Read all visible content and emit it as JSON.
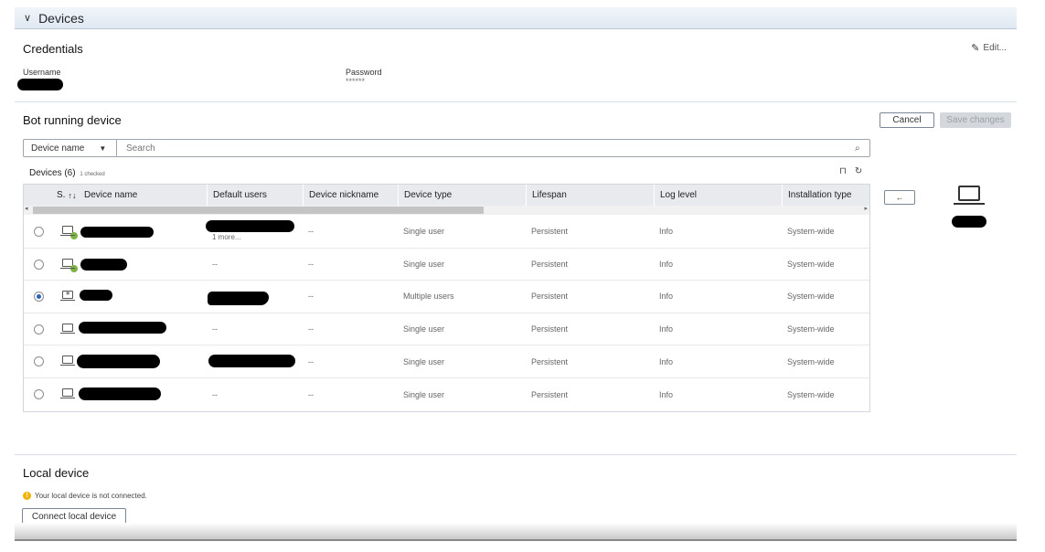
{
  "section": {
    "title": "Devices",
    "chevron_icon": "chevron-down-icon"
  },
  "credentials": {
    "title": "Credentials",
    "edit_label": "Edit...",
    "username_label": "Username",
    "password_label": "Password",
    "password_value": "******"
  },
  "bot": {
    "title": "Bot running device",
    "cancel_label": "Cancel",
    "save_label": "Save changes",
    "search": {
      "filter_label": "Device name",
      "placeholder": "Search"
    },
    "devices_count": "Devices (6)",
    "checked_label": "1 checked",
    "arrow_label": "←"
  },
  "table": {
    "headers": [
      "S.",
      "Device name",
      "Default users",
      "Device nickname",
      "Device type",
      "Lifespan",
      "Log level",
      "Installation type"
    ],
    "sort_icon": "↑↓",
    "rows": [
      {
        "selected": false,
        "status": "connected",
        "default_users_more": "1 more...",
        "nickname": "--",
        "device_type": "Single user",
        "lifespan": "Persistent",
        "log_level": "Info",
        "installation_type": "System-wide"
      },
      {
        "selected": false,
        "status": "connected",
        "default_users": "--",
        "nickname": "--",
        "device_type": "Single user",
        "lifespan": "Persistent",
        "log_level": "Info",
        "installation_type": "System-wide"
      },
      {
        "selected": true,
        "status": "featured",
        "nickname": "--",
        "device_type": "Multiple users",
        "lifespan": "Persistent",
        "log_level": "Info",
        "installation_type": "System-wide"
      },
      {
        "selected": false,
        "status": "plain",
        "default_users": "--",
        "nickname": "--",
        "device_type": "Single user",
        "lifespan": "Persistent",
        "log_level": "Info",
        "installation_type": "System-wide"
      },
      {
        "selected": false,
        "status": "plain",
        "nickname": "--",
        "device_type": "Single user",
        "lifespan": "Persistent",
        "log_level": "Info",
        "installation_type": "System-wide"
      },
      {
        "selected": false,
        "status": "plain",
        "default_users": "--",
        "nickname": "--",
        "device_type": "Single user",
        "lifespan": "Persistent",
        "log_level": "Info",
        "installation_type": "System-wide"
      }
    ]
  },
  "local": {
    "title": "Local device",
    "warning": "Your local device is not connected.",
    "connect_label": "Connect local device"
  }
}
